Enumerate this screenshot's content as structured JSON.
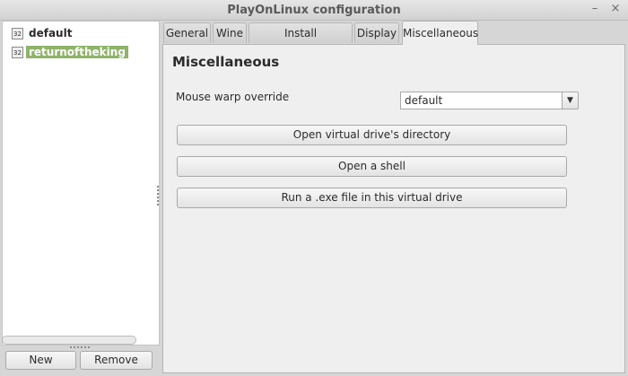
{
  "window": {
    "title": "PlayOnLinux configuration",
    "minimize_glyph": "–",
    "close_glyph": "×"
  },
  "sidebar": {
    "items": [
      {
        "badge": "32",
        "label": "default",
        "selected": false
      },
      {
        "badge": "32",
        "label": "returnoftheking",
        "selected": true
      }
    ],
    "new_label": "New",
    "remove_label": "Remove"
  },
  "tabs": [
    {
      "label": "General"
    },
    {
      "label": "Wine"
    },
    {
      "label": "Install components"
    },
    {
      "label": "Display"
    },
    {
      "label": "Miscellaneous",
      "active": true
    }
  ],
  "misc": {
    "heading": "Miscellaneous",
    "mouse_warp_label": "Mouse warp override",
    "mouse_warp_value": "default",
    "dropdown_glyph": "▼",
    "buttons": {
      "open_dir": "Open virtual drive's directory",
      "open_shell": "Open a shell",
      "run_exe": "Run a .exe file in this virtual drive"
    }
  },
  "colors": {
    "selection": "#8fb36a",
    "panel": "#efefef",
    "window": "#d6d6d6"
  }
}
